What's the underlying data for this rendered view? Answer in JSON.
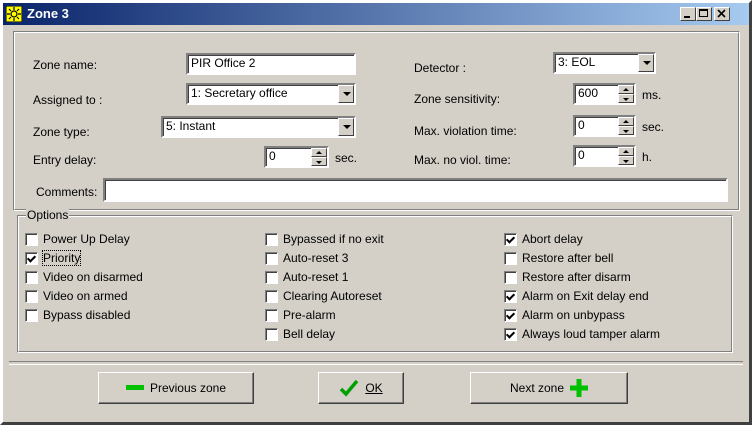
{
  "window": {
    "title": "Zone 3"
  },
  "form": {
    "zone_name_label": "Zone name:",
    "zone_name_value": "PIR Office 2",
    "assigned_label": "Assigned to :",
    "assigned_value": "1: Secretary office",
    "zone_type_label": "Zone type:",
    "zone_type_value": "5: Instant",
    "entry_delay_label": "Entry delay:",
    "entry_delay_value": "0",
    "entry_delay_unit": "sec.",
    "detector_label": "Detector :",
    "detector_value": "3: EOL",
    "sensitivity_label": "Zone sensitivity:",
    "sensitivity_value": "600",
    "sensitivity_unit": "ms.",
    "max_violation_label": "Max. violation time:",
    "max_violation_value": "0",
    "max_violation_unit": "sec.",
    "max_no_viol_label": "Max. no viol. time:",
    "max_no_viol_value": "0",
    "max_no_viol_unit": "h.",
    "comments_label": "Comments:",
    "comments_value": ""
  },
  "options": {
    "title": "Options",
    "col1": [
      {
        "label": "Power Up Delay",
        "checked": false
      },
      {
        "label": "Priority",
        "checked": true
      },
      {
        "label": "Video on disarmed",
        "checked": false
      },
      {
        "label": "Video on armed",
        "checked": false
      },
      {
        "label": "Bypass disabled",
        "checked": false
      }
    ],
    "col2": [
      {
        "label": "Bypassed if no exit",
        "checked": false
      },
      {
        "label": "Auto-reset 3",
        "checked": false
      },
      {
        "label": "Auto-reset 1",
        "checked": false
      },
      {
        "label": "Clearing Autoreset",
        "checked": false
      },
      {
        "label": "Pre-alarm",
        "checked": false
      },
      {
        "label": "Bell delay",
        "checked": false
      }
    ],
    "col3": [
      {
        "label": "Abort delay",
        "checked": true
      },
      {
        "label": "Restore after bell",
        "checked": false
      },
      {
        "label": "Restore after disarm",
        "checked": false
      },
      {
        "label": "Alarm on Exit delay end",
        "checked": true
      },
      {
        "label": "Alarm on unbypass",
        "checked": true
      },
      {
        "label": "Always loud tamper alarm",
        "checked": true
      }
    ]
  },
  "buttons": {
    "previous": "Previous zone",
    "ok": "OK",
    "next": "Next zone"
  },
  "colors": {
    "accent_green": "#00c000",
    "title_bar": "#0a246a"
  }
}
